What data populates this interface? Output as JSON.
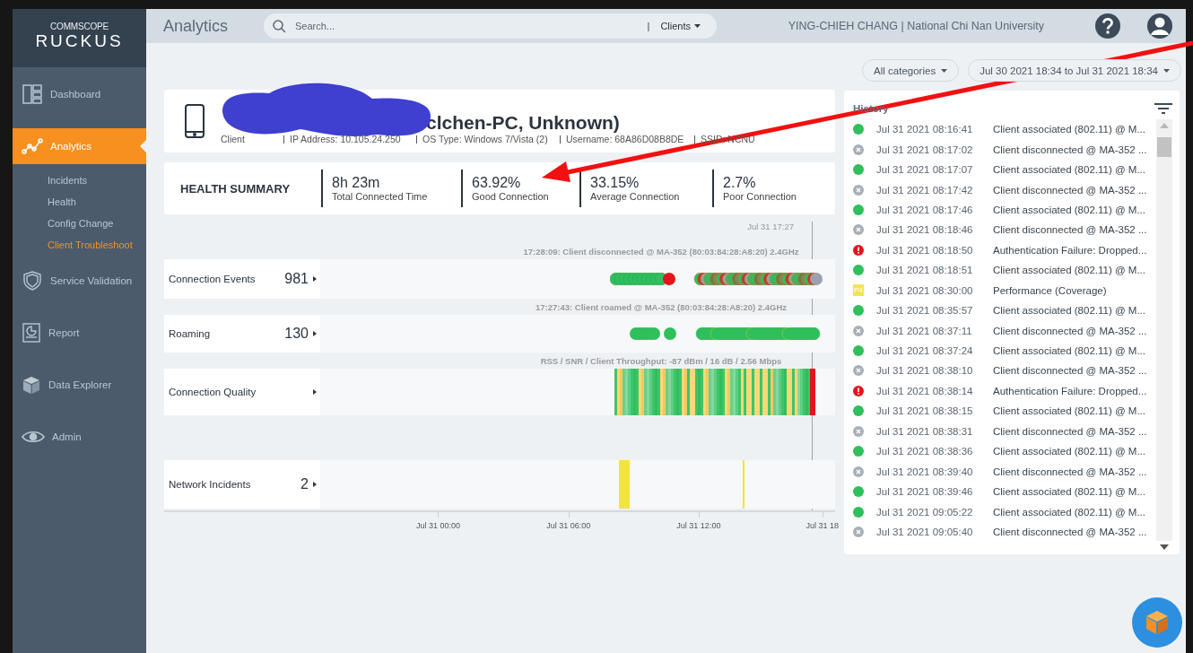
{
  "brand": {
    "top": "COMMSCOPE",
    "bottom": "RUCKUS"
  },
  "nav": [
    {
      "label": "Dashboard",
      "selected": false
    },
    {
      "label": "Analytics",
      "selected": true,
      "children": [
        {
          "label": "Incidents",
          "selected": false
        },
        {
          "label": "Health",
          "selected": false
        },
        {
          "label": "Config Change",
          "selected": false
        },
        {
          "label": "Client Troubleshoot",
          "selected": true
        }
      ]
    },
    {
      "label": "Service Validation",
      "selected": false
    },
    {
      "label": "Report",
      "selected": false
    },
    {
      "label": "Data Explorer",
      "selected": false
    },
    {
      "label": "Admin",
      "selected": false
    }
  ],
  "header": {
    "title": "Analytics",
    "search": {
      "placeholder": "Search..."
    },
    "scope_separator": "|",
    "scope": "Clients",
    "user": "YING-CHIEH CHANG | National Chi Nan University"
  },
  "filters": {
    "category": "All categories",
    "date_range": "Jul 30 2021 18:34 to Jul 31 2021 18:34"
  },
  "client": {
    "title": "clchen-PC, Unknown)",
    "info": [
      "Client",
      "IP Address: 10.105.24.250",
      "OS Type: Windows 7/Vista (2)",
      "Username: 68A86D08B8DE",
      "SSID: NCNU"
    ]
  },
  "health_summary": {
    "title": "HEALTH SUMMARY",
    "metrics": [
      {
        "value": "8h 23m",
        "label": "Total Connected Time"
      },
      {
        "value": "63.92%",
        "label": "Good Connection"
      },
      {
        "value": "33.15%",
        "label": "Average Connection"
      },
      {
        "value": "2.7%",
        "label": "Poor Connection"
      }
    ]
  },
  "timeline": {
    "cursor_label": "Jul 31 17:27",
    "rows": [
      {
        "kind": "events",
        "caption": "17:28:09: Client disconnected @ MA-352 (80:03:84:28:A8:20) 2.4GHz",
        "label": "Connection Events",
        "count": "981"
      },
      {
        "kind": "roaming",
        "caption": "17:27:43: Client roamed @ MA-352 (80:03:84:28:A8:20) 2.4GHz",
        "label": "Roaming",
        "count": "130"
      },
      {
        "kind": "quality",
        "caption": "RSS / SNR / Client Throughput: -87 dBm / 16 dB / 2.56 Mbps",
        "label": "Connection Quality"
      },
      {
        "kind": "incidents",
        "label": "Network Incidents",
        "count": "2"
      }
    ],
    "axis_labels": [
      "Jul 31 00:00",
      "Jul 31 06:00",
      "Jul 31 12:00",
      "Jul 31 18"
    ]
  },
  "history": {
    "title": "History",
    "rows": [
      {
        "kind": "ok",
        "time": "Jul 31 2021 08:16:41",
        "event": "Client associated (802.11) @ M..."
      },
      {
        "kind": "disconnect",
        "time": "Jul 31 2021 08:17:02",
        "event": "Client disconnected @ MA-352 ..."
      },
      {
        "kind": "ok",
        "time": "Jul 31 2021 08:17:07",
        "event": "Client associated (802.11) @ M..."
      },
      {
        "kind": "disconnect",
        "time": "Jul 31 2021 08:17:42",
        "event": "Client disconnected @ MA-352 ..."
      },
      {
        "kind": "ok",
        "time": "Jul 31 2021 08:17:46",
        "event": "Client associated (802.11) @ M..."
      },
      {
        "kind": "disconnect",
        "time": "Jul 31 2021 08:18:46",
        "event": "Client disconnected @ MA-352 ..."
      },
      {
        "kind": "alert",
        "time": "Jul 31 2021 08:18:50",
        "event": "Authentication Failure: Dropped..."
      },
      {
        "kind": "ok",
        "time": "Jul 31 2021 08:18:51",
        "event": "Client associated (802.11) @ M..."
      },
      {
        "kind": "incident",
        "badge": "P4",
        "time": "Jul 31 2021 08:30:00",
        "event": "Performance (Coverage)"
      },
      {
        "kind": "ok",
        "time": "Jul 31 2021 08:35:57",
        "event": "Client associated (802.11) @ M..."
      },
      {
        "kind": "disconnect",
        "time": "Jul 31 2021 08:37:11",
        "event": "Client disconnected @ MA-352 ..."
      },
      {
        "kind": "ok",
        "time": "Jul 31 2021 08:37:24",
        "event": "Client associated (802.11) @ M..."
      },
      {
        "kind": "disconnect",
        "time": "Jul 31 2021 08:38:10",
        "event": "Client disconnected @ MA-352 ..."
      },
      {
        "kind": "alert",
        "time": "Jul 31 2021 08:38:14",
        "event": "Authentication Failure: Dropped..."
      },
      {
        "kind": "ok",
        "time": "Jul 31 2021 08:38:15",
        "event": "Client associated (802.11) @ M..."
      },
      {
        "kind": "disconnect",
        "time": "Jul 31 2021 08:38:31",
        "event": "Client disconnected @ MA-352 ..."
      },
      {
        "kind": "ok",
        "time": "Jul 31 2021 08:38:36",
        "event": "Client associated (802.11) @ M..."
      },
      {
        "kind": "disconnect",
        "time": "Jul 31 2021 08:39:40",
        "event": "Client disconnected @ MA-352 ..."
      },
      {
        "kind": "ok",
        "time": "Jul 31 2021 08:39:46",
        "event": "Client associated (802.11) @ M..."
      },
      {
        "kind": "ok",
        "time": "Jul 31 2021 09:05:22",
        "event": "Client associated (802.11) @ M..."
      },
      {
        "kind": "disconnect",
        "time": "Jul 31 2021 09:05:40",
        "event": "Client disconnected @ MA-352 ..."
      }
    ]
  }
}
